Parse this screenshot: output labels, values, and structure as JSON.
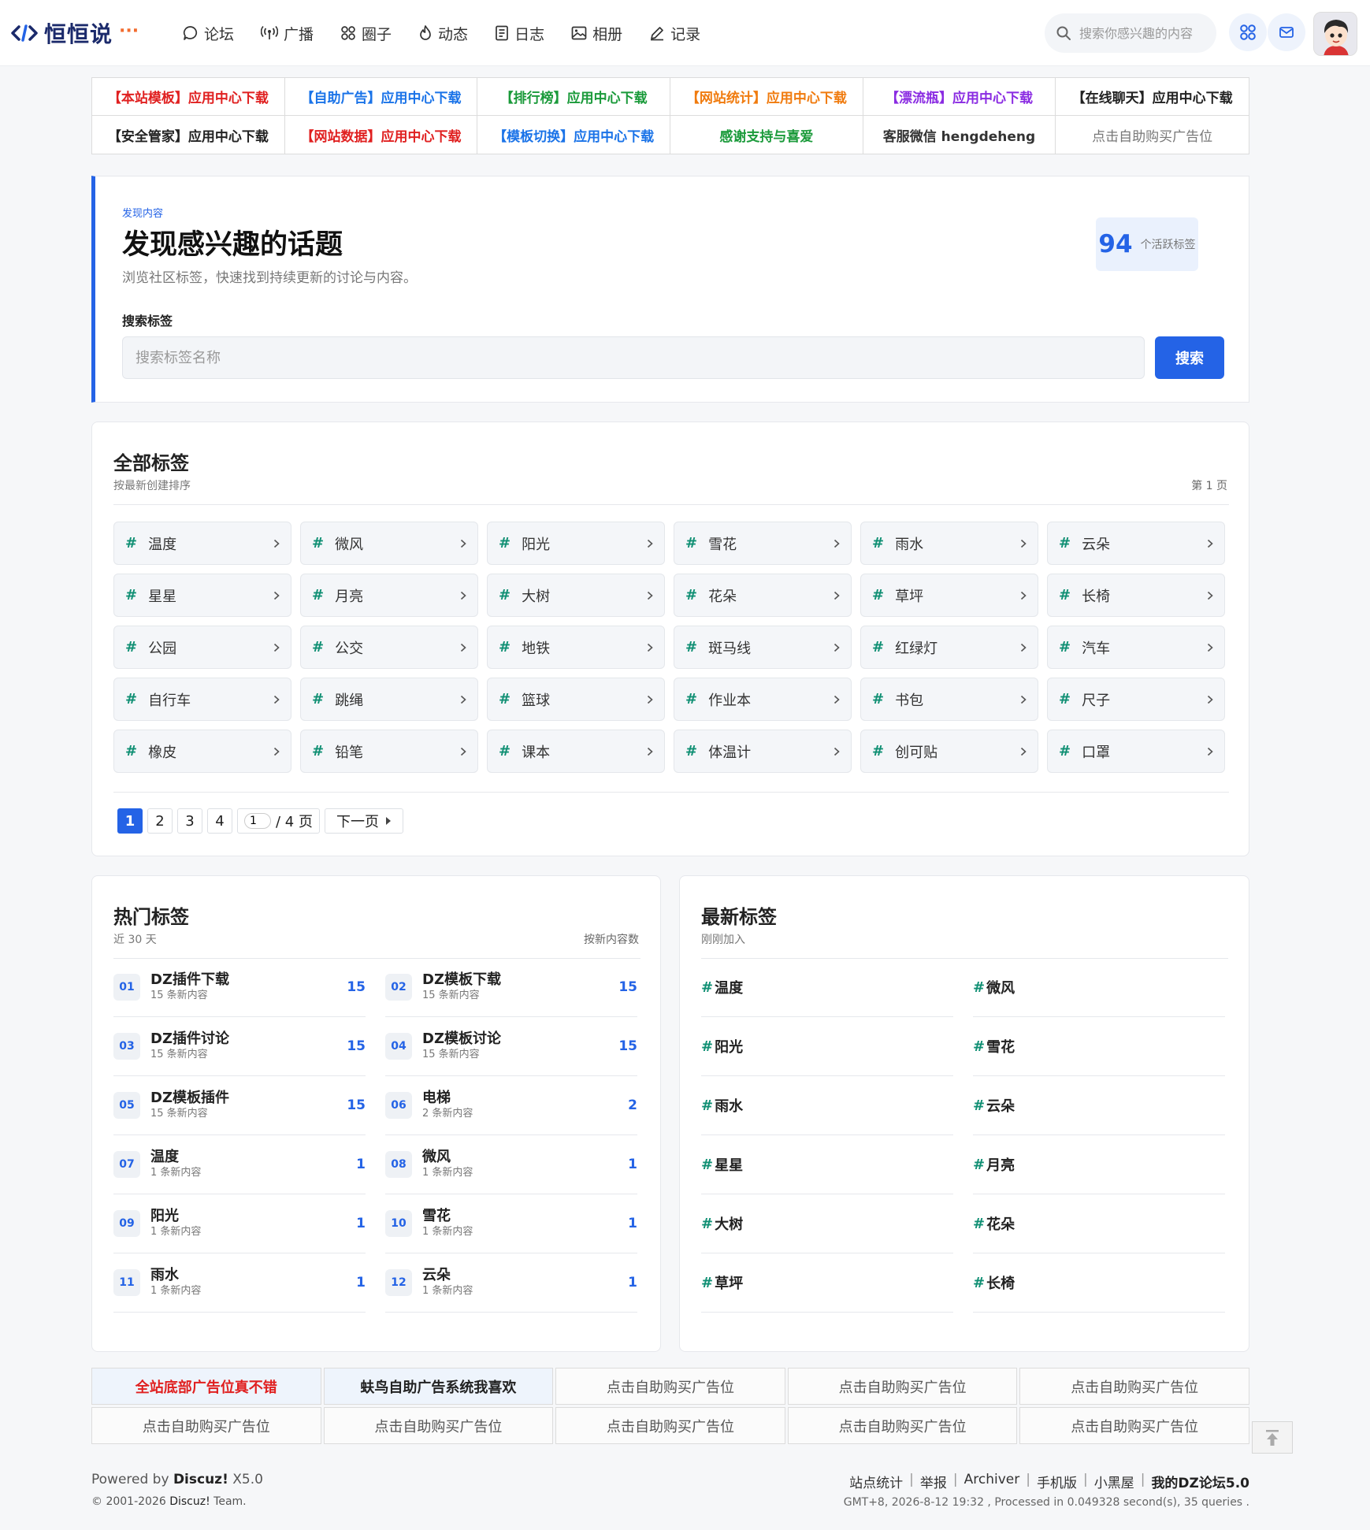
{
  "header": {
    "logo_text": "恒恒说",
    "logo_dots": "···",
    "nav": [
      {
        "label": "论坛",
        "icon": "chat-bubble-icon"
      },
      {
        "label": "广播",
        "icon": "broadcast-icon"
      },
      {
        "label": "圈子",
        "icon": "grid-circles-icon"
      },
      {
        "label": "动态",
        "icon": "flame-icon"
      },
      {
        "label": "日志",
        "icon": "document-icon"
      },
      {
        "label": "相册",
        "icon": "image-icon"
      },
      {
        "label": "记录",
        "icon": "pencil-icon"
      }
    ],
    "search_placeholder": "搜索你感兴趣的内容"
  },
  "top_ads": [
    {
      "text": "【本站模板】应用中心下载",
      "color": "#e02020"
    },
    {
      "text": "【自助广告】应用中心下载",
      "color": "#1a73e8"
    },
    {
      "text": "【排行榜】应用中心下载",
      "color": "#1a9a3a"
    },
    {
      "text": "【网站统计】应用中心下载",
      "color": "#f07b0e"
    },
    {
      "text": "【漂流瓶】应用中心下载",
      "color": "#8a2be2"
    },
    {
      "text": "【在线聊天】应用中心下载",
      "color": "#222222"
    },
    {
      "text": "【安全管家】应用中心下载",
      "color": "#222222"
    },
    {
      "text": "【网站数据】应用中心下载",
      "color": "#e02020"
    },
    {
      "text": "【模板切换】应用中心下载",
      "color": "#1a73e8"
    },
    {
      "text": "感谢支持与喜爱",
      "color": "#1a9a3a"
    },
    {
      "text": "客服微信 hengdeheng",
      "color": "#333333"
    },
    {
      "text": "点击自助购买广告位",
      "color": "#777777",
      "normal": true
    }
  ],
  "hero": {
    "kicker": "发现内容",
    "title": "发现感兴趣的话题",
    "desc": "浏览社区标签，快速找到持续更新的讨论与内容。",
    "stat_num": "94",
    "stat_label": "个活跃标签",
    "search_label": "搜索标签",
    "search_placeholder": "搜索标签名称",
    "search_button": "搜索"
  },
  "all_tags": {
    "title": "全部标签",
    "subtitle": "按最新创建排序",
    "page_info": "第 1 页",
    "tags": [
      "温度",
      "微风",
      "阳光",
      "雪花",
      "雨水",
      "云朵",
      "星星",
      "月亮",
      "大树",
      "花朵",
      "草坪",
      "长椅",
      "公园",
      "公交",
      "地铁",
      "斑马线",
      "红绿灯",
      "汽车",
      "自行车",
      "跳绳",
      "篮球",
      "作业本",
      "书包",
      "尺子",
      "橡皮",
      "铅笔",
      "课本",
      "体温计",
      "创可贴",
      "口罩"
    ],
    "pager": {
      "pages": [
        "1",
        "2",
        "3",
        "4"
      ],
      "current": "1",
      "input_value": "1",
      "total": "/ 4 页",
      "next": "下一页"
    }
  },
  "hot_tags": {
    "title": "热门标签",
    "subtitle": "近 30 天",
    "right": "按新内容数",
    "items": [
      {
        "rank": "01",
        "name": "DZ插件下载",
        "count_text": "15 条新内容",
        "num": "15"
      },
      {
        "rank": "02",
        "name": "DZ模板下载",
        "count_text": "15 条新内容",
        "num": "15"
      },
      {
        "rank": "03",
        "name": "DZ插件讨论",
        "count_text": "15 条新内容",
        "num": "15"
      },
      {
        "rank": "04",
        "name": "DZ模板讨论",
        "count_text": "15 条新内容",
        "num": "15"
      },
      {
        "rank": "05",
        "name": "DZ模板插件",
        "count_text": "15 条新内容",
        "num": "15"
      },
      {
        "rank": "06",
        "name": "电梯",
        "count_text": "2 条新内容",
        "num": "2"
      },
      {
        "rank": "07",
        "name": "温度",
        "count_text": "1 条新内容",
        "num": "1"
      },
      {
        "rank": "08",
        "name": "微风",
        "count_text": "1 条新内容",
        "num": "1"
      },
      {
        "rank": "09",
        "name": "阳光",
        "count_text": "1 条新内容",
        "num": "1"
      },
      {
        "rank": "10",
        "name": "雪花",
        "count_text": "1 条新内容",
        "num": "1"
      },
      {
        "rank": "11",
        "name": "雨水",
        "count_text": "1 条新内容",
        "num": "1"
      },
      {
        "rank": "12",
        "name": "云朵",
        "count_text": "1 条新内容",
        "num": "1"
      }
    ]
  },
  "new_tags": {
    "title": "最新标签",
    "subtitle": "刚刚加入",
    "items": [
      "温度",
      "微风",
      "阳光",
      "雪花",
      "雨水",
      "云朵",
      "星星",
      "月亮",
      "大树",
      "花朵",
      "草坪",
      "长椅"
    ]
  },
  "bottom_ads": [
    {
      "text": "全站底部广告位真不错",
      "color": "#e02020",
      "bold": true,
      "bg": "#eef4fc"
    },
    {
      "text": "蚨鸟自助广告系统我喜欢",
      "color": "#222222",
      "bold": true,
      "bg": "#eef4fc"
    },
    {
      "text": "点击自助购买广告位"
    },
    {
      "text": "点击自助购买广告位"
    },
    {
      "text": "点击自助购买广告位"
    },
    {
      "text": "点击自助购买广告位"
    },
    {
      "text": "点击自助购买广告位"
    },
    {
      "text": "点击自助购买广告位"
    },
    {
      "text": "点击自助购买广告位"
    },
    {
      "text": "点击自助购买广告位"
    }
  ],
  "footer": {
    "powered_prefix": "Powered by ",
    "powered_brand": "Discuz!",
    "powered_version": " X5.0",
    "copyright_prefix": "© 2001-2026 ",
    "copyright_brand": "Discuz!",
    "copyright_suffix": " Team.",
    "links": [
      "站点统计",
      "举报",
      "Archiver",
      "手机版",
      "小黑屋"
    ],
    "site_name": "我的DZ论坛5.0",
    "stats": "GMT+8, 2026-8-12 19:32 , Processed in 0.049328 second(s), 35 queries ."
  }
}
